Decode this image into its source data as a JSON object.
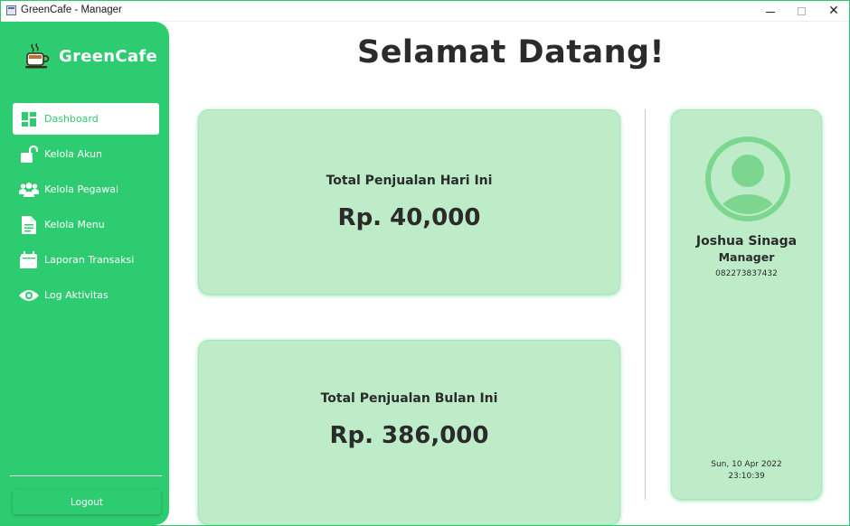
{
  "window": {
    "title": "GreenCafe - Manager",
    "close_glyph": "✕"
  },
  "sidebar": {
    "brand": "GreenCafe",
    "brand_icon": "coffee-cup-icon",
    "items": [
      {
        "label": "Dashboard",
        "icon": "dashboard-icon",
        "active": true
      },
      {
        "label": "Kelola Akun",
        "icon": "unlock-icon",
        "active": false
      },
      {
        "label": "Kelola Pegawai",
        "icon": "users-icon",
        "active": false
      },
      {
        "label": "Kelola Menu",
        "icon": "document-icon",
        "active": false
      },
      {
        "label": "Laporan Transaksi",
        "icon": "calendar-icon",
        "active": false
      },
      {
        "label": "Log Aktivitas",
        "icon": "eye-icon",
        "active": false
      }
    ],
    "logout_label": "Logout"
  },
  "main": {
    "heading": "Selamat Datang!",
    "stats": [
      {
        "title": "Total Penjualan Hari Ini",
        "value": "Rp. 40,000"
      },
      {
        "title": "Total Penjualan Bulan Ini",
        "value": "Rp. 386,000"
      }
    ]
  },
  "profile": {
    "name": "Joshua Sinaga",
    "role": "Manager",
    "phone": "082273837432",
    "date": "Sun, 10 Apr 2022",
    "time": "23:10:39"
  },
  "colors": {
    "accent": "#2ecc71",
    "card": "#beecc8",
    "avatar": "#7dd68f",
    "text": "#2b2b2b"
  }
}
